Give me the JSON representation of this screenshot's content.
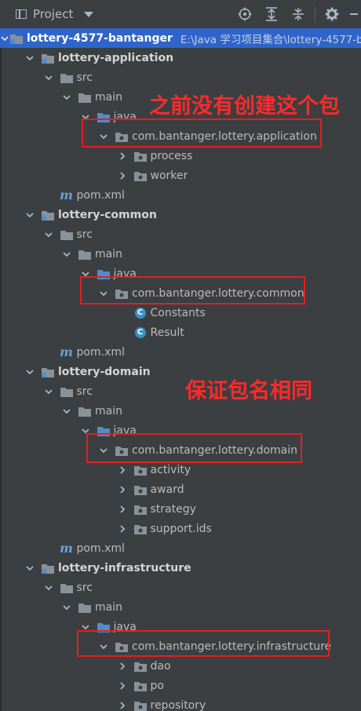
{
  "toolbar": {
    "title": "Project",
    "icons": [
      "crosshair-icon",
      "expand-all-icon",
      "collapse-all-icon",
      "gear-icon",
      "minimize-icon"
    ]
  },
  "tree": {
    "root": {
      "name": "lottery-4577-bantanger",
      "path": "E:\\Java 学习项目集合\\lottery-4577-b"
    },
    "rows": [
      {
        "id": "app-module",
        "label": "lottery-application",
        "depth": 1,
        "kind": "module",
        "arrow": "down"
      },
      {
        "id": "app-src",
        "label": "src",
        "depth": 2,
        "kind": "folder",
        "arrow": "down"
      },
      {
        "id": "app-main",
        "label": "main",
        "depth": 3,
        "kind": "folder",
        "arrow": "down"
      },
      {
        "id": "app-java",
        "label": "java",
        "depth": 4,
        "kind": "source",
        "arrow": "down"
      },
      {
        "id": "app-pkg",
        "label": "com.bantanger.lottery.application",
        "depth": 5,
        "kind": "package",
        "arrow": "down"
      },
      {
        "id": "app-process",
        "label": "process",
        "depth": 6,
        "kind": "package",
        "arrow": "right"
      },
      {
        "id": "app-worker",
        "label": "worker",
        "depth": 6,
        "kind": "package",
        "arrow": "right"
      },
      {
        "id": "app-pom",
        "label": "pom.xml",
        "depth": 2,
        "kind": "maven",
        "arrow": "none"
      },
      {
        "id": "common-module",
        "label": "lottery-common",
        "depth": 1,
        "kind": "module",
        "arrow": "down"
      },
      {
        "id": "common-src",
        "label": "src",
        "depth": 2,
        "kind": "folder",
        "arrow": "down"
      },
      {
        "id": "common-main",
        "label": "main",
        "depth": 3,
        "kind": "folder",
        "arrow": "down"
      },
      {
        "id": "common-java",
        "label": "java",
        "depth": 4,
        "kind": "source",
        "arrow": "down"
      },
      {
        "id": "common-pkg",
        "label": "com.bantanger.lottery.common",
        "depth": 5,
        "kind": "package",
        "arrow": "down"
      },
      {
        "id": "common-constants",
        "label": "Constants",
        "depth": 6,
        "kind": "class",
        "arrow": "none"
      },
      {
        "id": "common-result",
        "label": "Result",
        "depth": 6,
        "kind": "class",
        "arrow": "none"
      },
      {
        "id": "common-pom",
        "label": "pom.xml",
        "depth": 2,
        "kind": "maven",
        "arrow": "none"
      },
      {
        "id": "domain-module",
        "label": "lottery-domain",
        "depth": 1,
        "kind": "module",
        "arrow": "down"
      },
      {
        "id": "domain-src",
        "label": "src",
        "depth": 2,
        "kind": "folder",
        "arrow": "down"
      },
      {
        "id": "domain-main",
        "label": "main",
        "depth": 3,
        "kind": "folder",
        "arrow": "down"
      },
      {
        "id": "domain-java",
        "label": "java",
        "depth": 4,
        "kind": "source",
        "arrow": "down"
      },
      {
        "id": "domain-pkg",
        "label": "com.bantanger.lottery.domain",
        "depth": 5,
        "kind": "package",
        "arrow": "down"
      },
      {
        "id": "domain-activity",
        "label": "activity",
        "depth": 6,
        "kind": "package",
        "arrow": "right"
      },
      {
        "id": "domain-award",
        "label": "award",
        "depth": 6,
        "kind": "package",
        "arrow": "right"
      },
      {
        "id": "domain-strategy",
        "label": "strategy",
        "depth": 6,
        "kind": "package",
        "arrow": "right"
      },
      {
        "id": "domain-support",
        "label": "support.ids",
        "depth": 6,
        "kind": "package",
        "arrow": "right"
      },
      {
        "id": "domain-pom",
        "label": "pom.xml",
        "depth": 2,
        "kind": "maven",
        "arrow": "none"
      },
      {
        "id": "infra-module",
        "label": "lottery-infrastructure",
        "depth": 1,
        "kind": "module",
        "arrow": "down"
      },
      {
        "id": "infra-src",
        "label": "src",
        "depth": 2,
        "kind": "folder",
        "arrow": "down"
      },
      {
        "id": "infra-main",
        "label": "main",
        "depth": 3,
        "kind": "folder",
        "arrow": "down"
      },
      {
        "id": "infra-java",
        "label": "java",
        "depth": 4,
        "kind": "source",
        "arrow": "down"
      },
      {
        "id": "infra-pkg",
        "label": "com.bantanger.lottery.infrastructure",
        "depth": 5,
        "kind": "package",
        "arrow": "down"
      },
      {
        "id": "infra-dao",
        "label": "dao",
        "depth": 6,
        "kind": "package",
        "arrow": "right"
      },
      {
        "id": "infra-po",
        "label": "po",
        "depth": 6,
        "kind": "package",
        "arrow": "right"
      },
      {
        "id": "infra-repository",
        "label": "repository",
        "depth": 6,
        "kind": "package",
        "arrow": "right"
      }
    ]
  },
  "annotations": {
    "note_1": "之前没有创建这个包",
    "note_2": "保证包名相同",
    "color": "#e41f1f"
  },
  "colors": {
    "background": "#3c3f41",
    "root_highlight": "#2f65ca",
    "folder": "#8a9199",
    "source_folder": "#4f8ec9",
    "maven": "#6aa0d8",
    "class_badge": "#3592c4"
  }
}
